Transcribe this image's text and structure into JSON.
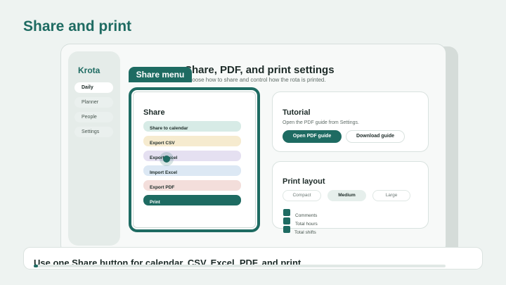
{
  "page": {
    "title": "Share and print"
  },
  "app": {
    "brand": "Krota",
    "nav": [
      {
        "label": "Daily",
        "active": true
      },
      {
        "label": "Planner",
        "active": false
      },
      {
        "label": "People",
        "active": false
      },
      {
        "label": "Settings",
        "active": false
      }
    ],
    "settings_title": "Share, PDF, and print settings",
    "settings_subtitle": "Choose how to share and control how the rota is printed."
  },
  "tutorial": {
    "title": "Tutorial",
    "text": "Open the PDF guide from Settings.",
    "open_label": "Open PDF guide",
    "download_label": "Download guide"
  },
  "print_layout": {
    "title": "Print layout",
    "options": [
      {
        "label": "Compact",
        "selected": false
      },
      {
        "label": "Medium",
        "selected": true
      },
      {
        "label": "Large",
        "selected": false
      }
    ],
    "checks": [
      "Comments",
      "Total hours",
      "Total shifts"
    ]
  },
  "share_menu": {
    "tooltip": "Share menu",
    "title": "Share",
    "items": [
      {
        "label": "Share to calendar",
        "color": "#d7ebe6"
      },
      {
        "label": "Export CSV",
        "color": "#f6ebcf"
      },
      {
        "label": "Export Excel",
        "color": "#e5e0f1"
      },
      {
        "label": "Import Excel",
        "color": "#dce8f4"
      },
      {
        "label": "Export PDF",
        "color": "#f3dedb"
      },
      {
        "label": "Print",
        "color": "#1e6b62"
      }
    ]
  },
  "caption": {
    "text": "Use one Share button for calendar, CSV, Excel, PDF, and print",
    "progress": 0.01
  },
  "colors": {
    "accent": "#1e6b62",
    "background": "#eef3f1"
  }
}
